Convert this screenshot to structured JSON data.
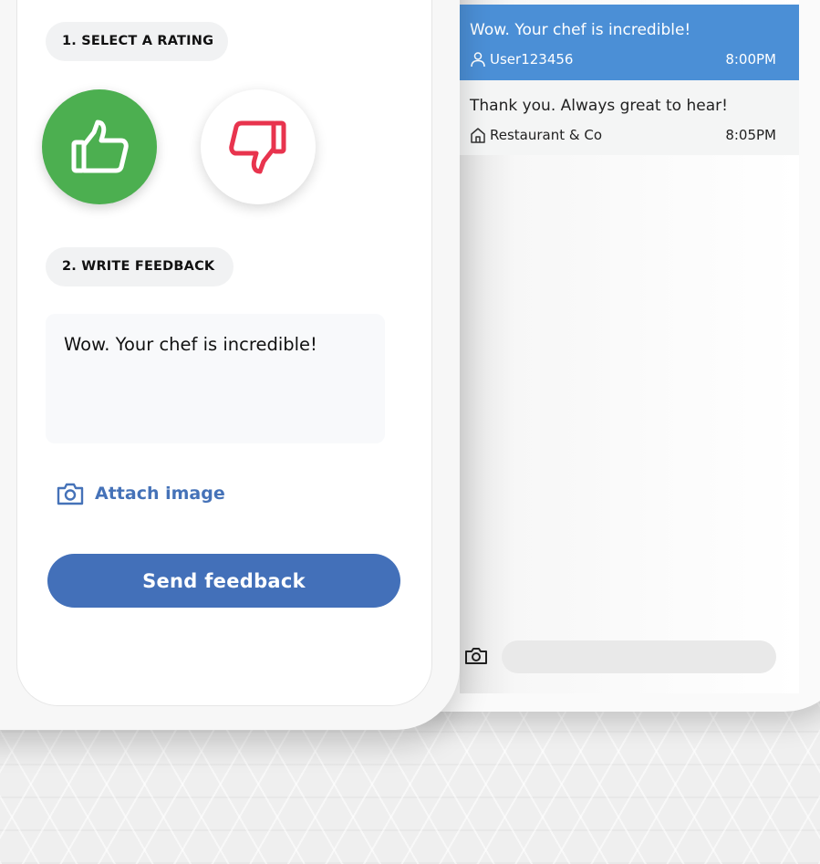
{
  "colors": {
    "accent_blue": "#4370b9",
    "chat_highlight": "#4b8fd6",
    "thumb_up_green": "#4caf50",
    "thumb_down_red": "#e8344e"
  },
  "form": {
    "step1_label": "1. SELECT A RATING",
    "step2_label": "2. WRITE FEEDBACK",
    "rating": {
      "thumbs_up_icon": "thumbs-up-icon",
      "thumbs_down_icon": "thumbs-down-icon",
      "selected": "thumbs-up"
    },
    "feedback_value": "Wow. Your chef is incredible!",
    "attach_icon": "camera-icon",
    "attach_label": "Attach image",
    "send_label": "Send feedback"
  },
  "chat": {
    "messages": [
      {
        "text": "Wow. Your chef is incredible!",
        "author": "User123456",
        "author_icon": "user-icon",
        "time": "8:00PM"
      },
      {
        "text": "Thank you. Always great to hear!",
        "author": "Restaurant & Co",
        "author_icon": "home-icon",
        "time": "8:05PM"
      }
    ],
    "camera_icon": "camera-icon",
    "input_value": ""
  }
}
